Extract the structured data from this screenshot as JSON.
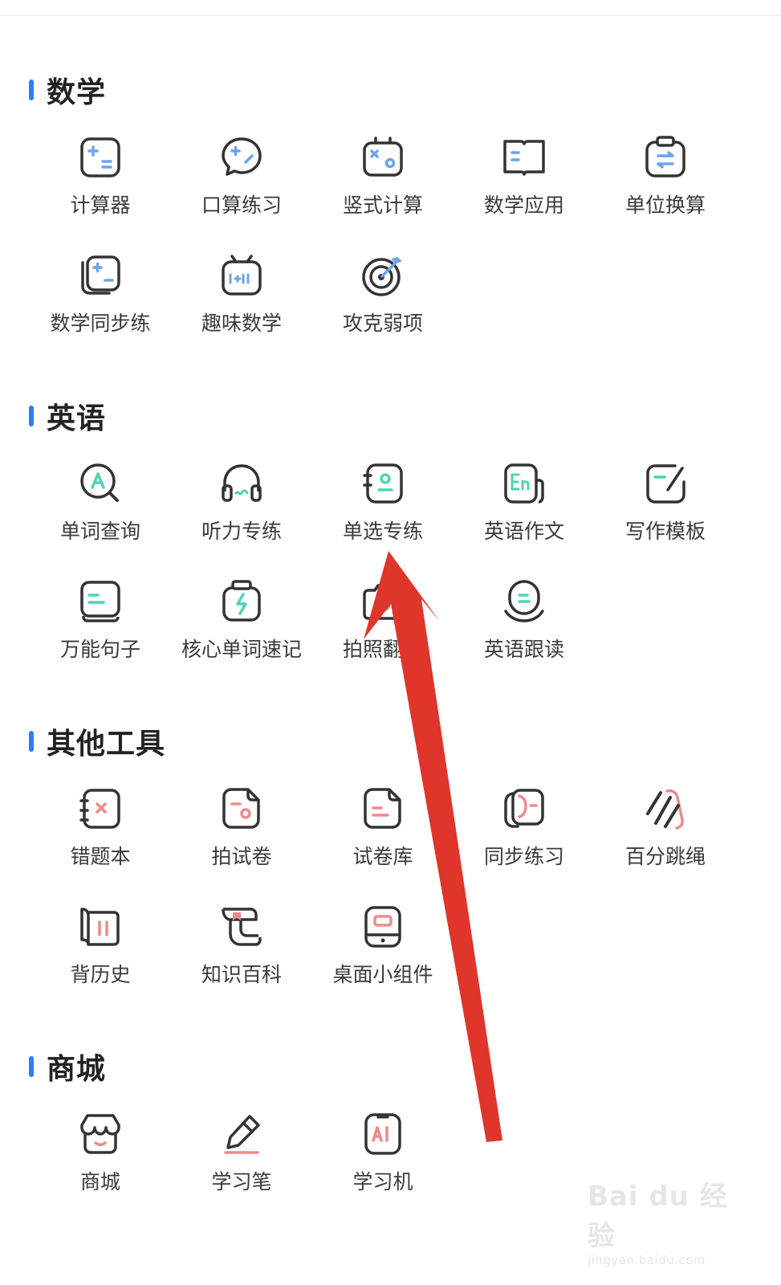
{
  "sections": [
    {
      "title": "数学",
      "items": [
        {
          "label": "计算器",
          "icon": "calculator-icon"
        },
        {
          "label": "口算练习",
          "icon": "oral-calc-icon"
        },
        {
          "label": "竖式计算",
          "icon": "vertical-calc-icon"
        },
        {
          "label": "数学应用",
          "icon": "math-book-icon"
        },
        {
          "label": "单位换算",
          "icon": "unit-convert-icon"
        },
        {
          "label": "数学同步练",
          "icon": "math-sync-icon"
        },
        {
          "label": "趣味数学",
          "icon": "fun-math-icon"
        },
        {
          "label": "攻克弱项",
          "icon": "target-icon"
        }
      ]
    },
    {
      "title": "英语",
      "items": [
        {
          "label": "单词查询",
          "icon": "word-search-icon"
        },
        {
          "label": "听力专练",
          "icon": "headphones-icon"
        },
        {
          "label": "单选专练",
          "icon": "single-choice-icon"
        },
        {
          "label": "英语作文",
          "icon": "english-essay-icon"
        },
        {
          "label": "写作模板",
          "icon": "writing-template-icon"
        },
        {
          "label": "万能句子",
          "icon": "sentence-icon"
        },
        {
          "label": "核心单词速记",
          "icon": "core-words-icon"
        },
        {
          "label": "拍照翻译",
          "icon": "camera-translate-icon"
        },
        {
          "label": "英语跟读",
          "icon": "read-along-icon"
        }
      ]
    },
    {
      "title": "其他工具",
      "items": [
        {
          "label": "错题本",
          "icon": "mistake-book-icon"
        },
        {
          "label": "拍试卷",
          "icon": "scan-paper-icon"
        },
        {
          "label": "试卷库",
          "icon": "paper-library-icon"
        },
        {
          "label": "同步练习",
          "icon": "sync-practice-icon"
        },
        {
          "label": "百分跳绳",
          "icon": "jump-rope-icon"
        },
        {
          "label": "背历史",
          "icon": "history-scroll-icon"
        },
        {
          "label": "知识百科",
          "icon": "encyclopedia-icon"
        },
        {
          "label": "桌面小组件",
          "icon": "widget-icon"
        }
      ]
    },
    {
      "title": "商城",
      "items": [
        {
          "label": "商城",
          "icon": "shop-icon"
        },
        {
          "label": "学习笔",
          "icon": "study-pen-icon"
        },
        {
          "label": "学习机",
          "icon": "study-machine-icon"
        }
      ]
    }
  ],
  "colors": {
    "accent": "#2f7cf6",
    "math_icon": "#6aa3f2",
    "english_icon": "#4fd3b5",
    "tools_icon": "#f08a8a",
    "outline": "#333333",
    "arrow": "#e0352b"
  },
  "watermark": {
    "brand": "Bai du 经验",
    "url": "jingyan.baidu.com"
  }
}
